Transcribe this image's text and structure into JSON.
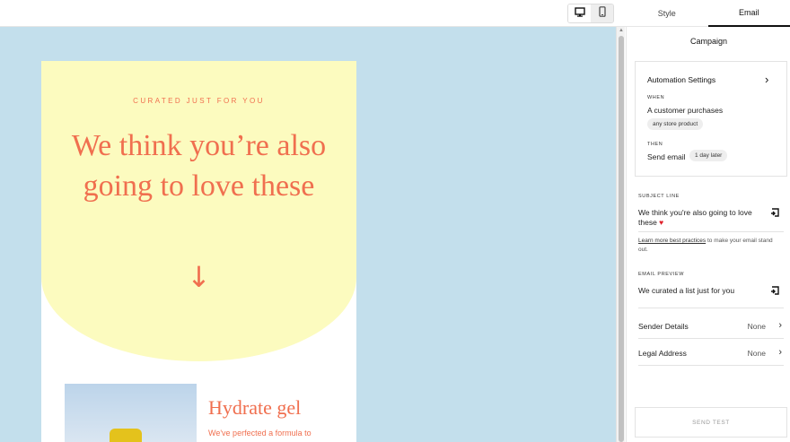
{
  "header": {
    "device_icons": [
      "desktop-icon",
      "mobile-icon"
    ],
    "tabs": [
      {
        "label": "Style",
        "active": false
      },
      {
        "label": "Email",
        "active": true
      }
    ]
  },
  "email": {
    "eyebrow": "CURATED JUST FOR YOU",
    "headline": "We think you’re also going to love these",
    "arrow": "↓",
    "product": {
      "title": "Hydrate gel",
      "description": "We've perfected a formula to"
    },
    "colors": {
      "accent": "#f06f4f",
      "hero_bg": "#fcfbbf",
      "canvas_bg": "#c3dfec"
    }
  },
  "panel": {
    "title": "Campaign",
    "automation": {
      "title": "Automation Settings",
      "chevron": "›",
      "when_label": "WHEN",
      "when_text": "A customer purchases",
      "when_pill": "any store product",
      "then_label": "THEN",
      "then_text": "Send email",
      "then_pill": "1 day later"
    },
    "subject": {
      "label": "SUBJECT LINE",
      "value": "We think you're also going to love these",
      "heart": "♥",
      "help_link": "Learn more best practices",
      "help_rest": " to make your email stand out."
    },
    "preview": {
      "label": "EMAIL PREVIEW",
      "value": "We curated a list just for you"
    },
    "sender": {
      "label": "Sender Details",
      "value": "None"
    },
    "legal": {
      "label": "Legal Address",
      "value": "None"
    },
    "send_test": "SEND TEST"
  }
}
